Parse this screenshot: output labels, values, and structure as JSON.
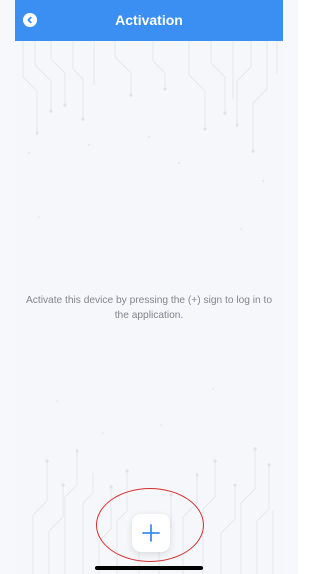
{
  "header": {
    "title": "Activation"
  },
  "main": {
    "message": "Activate this device by pressing the (+) sign to log in to the application."
  },
  "colors": {
    "header_background": "#3b8ff3",
    "header_text": "#ffffff",
    "message_text": "#7f8590",
    "plus_icon": "#3b8ff3",
    "highlight_ring": "#d93030"
  },
  "icons": {
    "back": "back-icon",
    "add": "plus-icon"
  }
}
